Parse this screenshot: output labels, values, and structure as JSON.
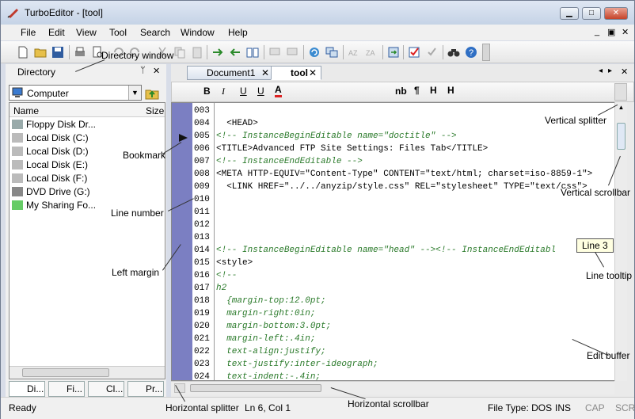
{
  "window": {
    "title": "TurboEditor - [tool]",
    "min": "▭",
    "max": "□",
    "close": "✕"
  },
  "menu": [
    "File",
    "Edit",
    "View",
    "Tool",
    "Search",
    "Window",
    "Help"
  ],
  "mdi_controls": [
    "_",
    "▣",
    "✕"
  ],
  "directory": {
    "title": "Directory",
    "pin": "ᛘ",
    "close": "✕",
    "location": "Computer",
    "col_name": "Name",
    "col_size": "Size",
    "items": [
      "Floppy Disk Dr...",
      "Local Disk (C:)",
      "Local Disk (D:)",
      "Local Disk (E:)",
      "Local Disk (F:)",
      "DVD Drive (G:)",
      "My Sharing Fo..."
    ],
    "tabs": [
      "Di...",
      "Fi...",
      "Cl...",
      "Pr..."
    ]
  },
  "doc_tabs": [
    {
      "label": "Document1",
      "close": "✕"
    },
    {
      "label": "tool",
      "close": "✕"
    }
  ],
  "format_bar": [
    "B",
    "I",
    "U",
    "U",
    "A",
    "nb",
    "¶",
    "H",
    "H"
  ],
  "editor": {
    "lines": [
      {
        "num": "003",
        "text": ""
      },
      {
        "num": "004",
        "text": "  <HEAD>"
      },
      {
        "num": "005",
        "text": "<!-- InstanceBeginEditable name=\"doctitle\" -->",
        "comment": true
      },
      {
        "num": "006",
        "text": "<TITLE>Advanced FTP Site Settings: Files Tab</TITLE>"
      },
      {
        "num": "007",
        "text": "<!-- InstanceEndEditable -->",
        "comment": true
      },
      {
        "num": "008",
        "text": "<META HTTP-EQUIV=\"Content-Type\" CONTENT=\"text/html; charset=iso-8859-1\">"
      },
      {
        "num": "009",
        "text": "  <LINK HREF=\"../../anyzip/style.css\" REL=\"stylesheet\" TYPE=\"text/css\">"
      },
      {
        "num": "010",
        "text": ""
      },
      {
        "num": "011",
        "text": ""
      },
      {
        "num": "012",
        "text": ""
      },
      {
        "num": "013",
        "text": ""
      },
      {
        "num": "014",
        "text": "<!-- InstanceBeginEditable name=\"head\" --><!-- InstanceEndEditabl",
        "comment": true
      },
      {
        "num": "015",
        "text": "<style>"
      },
      {
        "num": "016",
        "text": "<!--",
        "comment": true
      },
      {
        "num": "017",
        "text": "h2",
        "comment": true
      },
      {
        "num": "018",
        "text": "  {margin-top:12.0pt;",
        "comment": true
      },
      {
        "num": "019",
        "text": "  margin-right:0in;",
        "comment": true
      },
      {
        "num": "020",
        "text": "  margin-bottom:3.0pt;",
        "comment": true
      },
      {
        "num": "021",
        "text": "  margin-left:.4in;",
        "comment": true
      },
      {
        "num": "022",
        "text": "  text-align:justify;",
        "comment": true
      },
      {
        "num": "023",
        "text": "  text-justify:inter-ideograph;",
        "comment": true
      },
      {
        "num": "024",
        "text": "  text-indent:-.4in;",
        "comment": true
      }
    ]
  },
  "tooltip": "Line 3",
  "status": {
    "ready": "Ready",
    "position": "Ln 6, Col 1",
    "filetype": "File Type: DOS",
    "ins": "INS",
    "cap": "CAP",
    "scr": "SCR"
  },
  "callouts": {
    "directory_window": "Directory window",
    "bookmark": "Bookmark",
    "line_number": "Line number",
    "left_margin": "Left margin",
    "vertical_splitter": "Vertical splitter",
    "vertical_scrollbar": "Vertical scrollbar",
    "line_tooltip": "Line tooltip",
    "edit_buffer": "Edit buffer",
    "horizontal_splitter": "Horizontal splitter",
    "horizontal_scrollbar": "Horizontal scrollbar"
  },
  "colors": {
    "left_margin": "#7b7fc2",
    "comment": "#2a7a2a",
    "title_bg": "#c5d3e6"
  }
}
